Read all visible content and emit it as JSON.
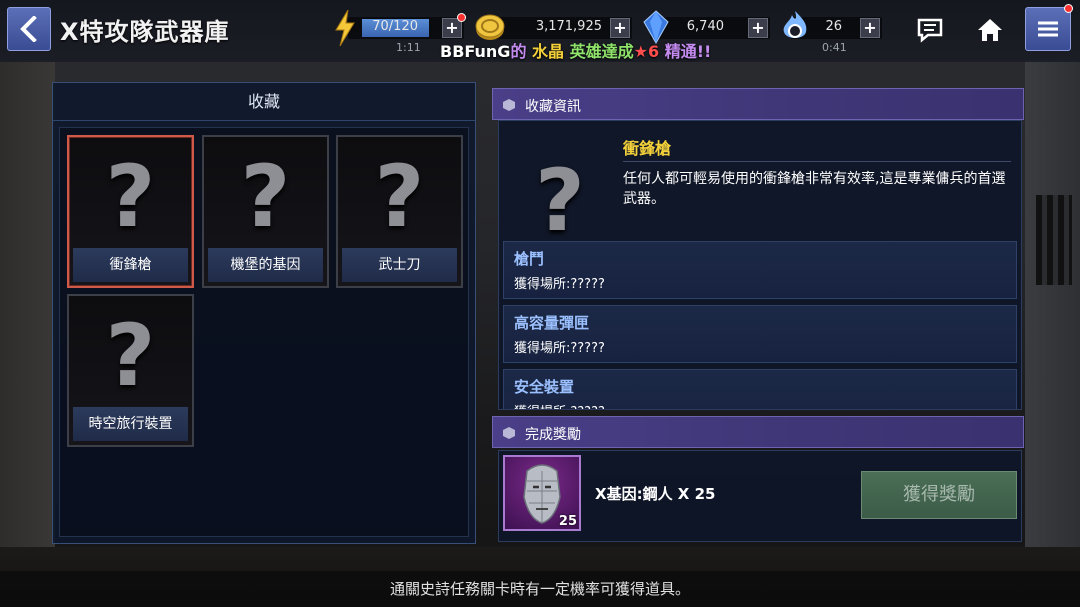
{
  "header": {
    "title": "X特攻隊武器庫",
    "energy": {
      "value": "70/120",
      "timer": "1:11",
      "fill": 0.58
    },
    "gold": {
      "value": "3,171,925"
    },
    "crystal": {
      "value": "6,740"
    },
    "stamina": {
      "value": "26",
      "timer": "0:41"
    },
    "ticker": {
      "name": "BBFunG",
      "of": "的",
      "item": "水晶",
      "verb": "英雄達成",
      "star": "★6",
      "rest": "精通!!"
    }
  },
  "collection": {
    "title": "收藏",
    "items": [
      {
        "label": "衝鋒槍",
        "glyph": "?"
      },
      {
        "label": "機堡的基因",
        "glyph": "?"
      },
      {
        "label": "武士刀",
        "glyph": "?"
      },
      {
        "label": "時空旅行裝置",
        "glyph": "?"
      }
    ]
  },
  "info": {
    "header": "收藏資訊",
    "glyph": "?",
    "name": "衝鋒槍",
    "description": "任何人都可輕易使用的衝鋒槍非常有效率,這是專業傭兵的首選武器。",
    "sources": [
      {
        "name": "槍鬥",
        "source": "獲得場所:?????"
      },
      {
        "name": "高容量彈匣",
        "source": "獲得場所:?????"
      },
      {
        "name": "安全裝置",
        "source": "獲得場所:?????"
      }
    ]
  },
  "reward": {
    "header": "完成獎勵",
    "level": "25",
    "text": "X基因:鋼人 X 25",
    "button": "獲得獎勵"
  },
  "footer": {
    "message": "通關史詩任務關卡時有一定機率可獲得道具。"
  },
  "colors": {
    "accent_gold": "#f5d23a",
    "selected_border": "#d05a4a",
    "section_header": "#4a3f88"
  }
}
